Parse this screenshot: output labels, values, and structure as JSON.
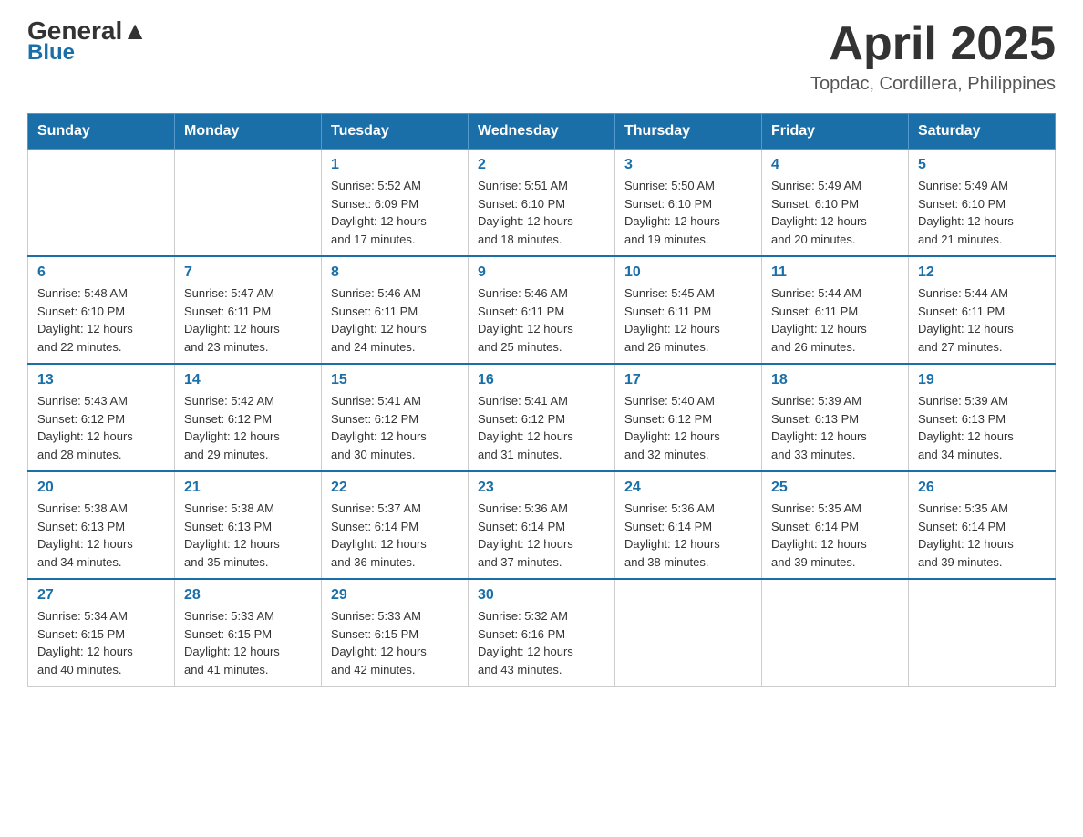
{
  "header": {
    "logo_general": "General",
    "logo_blue": "Blue",
    "month_title": "April 2025",
    "location": "Topdac, Cordillera, Philippines"
  },
  "days_of_week": [
    "Sunday",
    "Monday",
    "Tuesday",
    "Wednesday",
    "Thursday",
    "Friday",
    "Saturday"
  ],
  "weeks": [
    [
      {
        "day": "",
        "info": ""
      },
      {
        "day": "",
        "info": ""
      },
      {
        "day": "1",
        "info": "Sunrise: 5:52 AM\nSunset: 6:09 PM\nDaylight: 12 hours\nand 17 minutes."
      },
      {
        "day": "2",
        "info": "Sunrise: 5:51 AM\nSunset: 6:10 PM\nDaylight: 12 hours\nand 18 minutes."
      },
      {
        "day": "3",
        "info": "Sunrise: 5:50 AM\nSunset: 6:10 PM\nDaylight: 12 hours\nand 19 minutes."
      },
      {
        "day": "4",
        "info": "Sunrise: 5:49 AM\nSunset: 6:10 PM\nDaylight: 12 hours\nand 20 minutes."
      },
      {
        "day": "5",
        "info": "Sunrise: 5:49 AM\nSunset: 6:10 PM\nDaylight: 12 hours\nand 21 minutes."
      }
    ],
    [
      {
        "day": "6",
        "info": "Sunrise: 5:48 AM\nSunset: 6:10 PM\nDaylight: 12 hours\nand 22 minutes."
      },
      {
        "day": "7",
        "info": "Sunrise: 5:47 AM\nSunset: 6:11 PM\nDaylight: 12 hours\nand 23 minutes."
      },
      {
        "day": "8",
        "info": "Sunrise: 5:46 AM\nSunset: 6:11 PM\nDaylight: 12 hours\nand 24 minutes."
      },
      {
        "day": "9",
        "info": "Sunrise: 5:46 AM\nSunset: 6:11 PM\nDaylight: 12 hours\nand 25 minutes."
      },
      {
        "day": "10",
        "info": "Sunrise: 5:45 AM\nSunset: 6:11 PM\nDaylight: 12 hours\nand 26 minutes."
      },
      {
        "day": "11",
        "info": "Sunrise: 5:44 AM\nSunset: 6:11 PM\nDaylight: 12 hours\nand 26 minutes."
      },
      {
        "day": "12",
        "info": "Sunrise: 5:44 AM\nSunset: 6:11 PM\nDaylight: 12 hours\nand 27 minutes."
      }
    ],
    [
      {
        "day": "13",
        "info": "Sunrise: 5:43 AM\nSunset: 6:12 PM\nDaylight: 12 hours\nand 28 minutes."
      },
      {
        "day": "14",
        "info": "Sunrise: 5:42 AM\nSunset: 6:12 PM\nDaylight: 12 hours\nand 29 minutes."
      },
      {
        "day": "15",
        "info": "Sunrise: 5:41 AM\nSunset: 6:12 PM\nDaylight: 12 hours\nand 30 minutes."
      },
      {
        "day": "16",
        "info": "Sunrise: 5:41 AM\nSunset: 6:12 PM\nDaylight: 12 hours\nand 31 minutes."
      },
      {
        "day": "17",
        "info": "Sunrise: 5:40 AM\nSunset: 6:12 PM\nDaylight: 12 hours\nand 32 minutes."
      },
      {
        "day": "18",
        "info": "Sunrise: 5:39 AM\nSunset: 6:13 PM\nDaylight: 12 hours\nand 33 minutes."
      },
      {
        "day": "19",
        "info": "Sunrise: 5:39 AM\nSunset: 6:13 PM\nDaylight: 12 hours\nand 34 minutes."
      }
    ],
    [
      {
        "day": "20",
        "info": "Sunrise: 5:38 AM\nSunset: 6:13 PM\nDaylight: 12 hours\nand 34 minutes."
      },
      {
        "day": "21",
        "info": "Sunrise: 5:38 AM\nSunset: 6:13 PM\nDaylight: 12 hours\nand 35 minutes."
      },
      {
        "day": "22",
        "info": "Sunrise: 5:37 AM\nSunset: 6:14 PM\nDaylight: 12 hours\nand 36 minutes."
      },
      {
        "day": "23",
        "info": "Sunrise: 5:36 AM\nSunset: 6:14 PM\nDaylight: 12 hours\nand 37 minutes."
      },
      {
        "day": "24",
        "info": "Sunrise: 5:36 AM\nSunset: 6:14 PM\nDaylight: 12 hours\nand 38 minutes."
      },
      {
        "day": "25",
        "info": "Sunrise: 5:35 AM\nSunset: 6:14 PM\nDaylight: 12 hours\nand 39 minutes."
      },
      {
        "day": "26",
        "info": "Sunrise: 5:35 AM\nSunset: 6:14 PM\nDaylight: 12 hours\nand 39 minutes."
      }
    ],
    [
      {
        "day": "27",
        "info": "Sunrise: 5:34 AM\nSunset: 6:15 PM\nDaylight: 12 hours\nand 40 minutes."
      },
      {
        "day": "28",
        "info": "Sunrise: 5:33 AM\nSunset: 6:15 PM\nDaylight: 12 hours\nand 41 minutes."
      },
      {
        "day": "29",
        "info": "Sunrise: 5:33 AM\nSunset: 6:15 PM\nDaylight: 12 hours\nand 42 minutes."
      },
      {
        "day": "30",
        "info": "Sunrise: 5:32 AM\nSunset: 6:16 PM\nDaylight: 12 hours\nand 43 minutes."
      },
      {
        "day": "",
        "info": ""
      },
      {
        "day": "",
        "info": ""
      },
      {
        "day": "",
        "info": ""
      }
    ]
  ]
}
